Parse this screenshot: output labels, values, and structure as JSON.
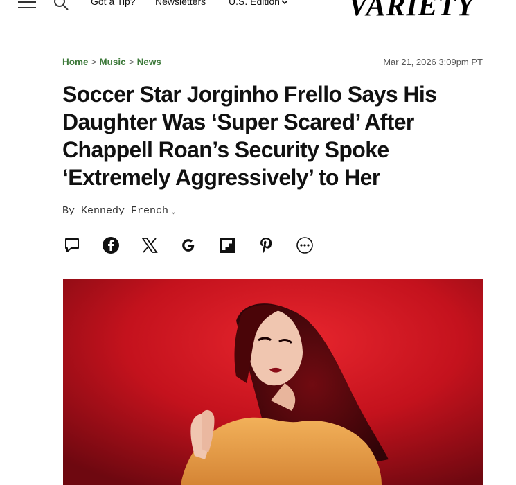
{
  "header": {
    "nav": {
      "tip": "Got a Tip?",
      "newsletters": "Newsletters",
      "edition": "U.S. Edition"
    },
    "logo_text": "VARIETY"
  },
  "breadcrumb": {
    "items": [
      "Home",
      "Music",
      "News"
    ],
    "separator": ">"
  },
  "article": {
    "date": "Mar 21, 2026 3:09pm PT",
    "headline": "Soccer Star Jorginho Frello Says His Daughter Was ‘Super Scared’ After Chappell Roan’s Security Spoke ‘Extremely Aggressively’ to Her",
    "byline_prefix": "By",
    "author": "Kennedy French"
  },
  "share": {
    "icons": [
      "comment-icon",
      "facebook-icon",
      "x-icon",
      "google-icon",
      "flipboard-icon",
      "pinterest-icon",
      "more-icon"
    ]
  },
  "colors": {
    "breadcrumb": "#3e7a3b",
    "hero_red": "#c8121e"
  }
}
